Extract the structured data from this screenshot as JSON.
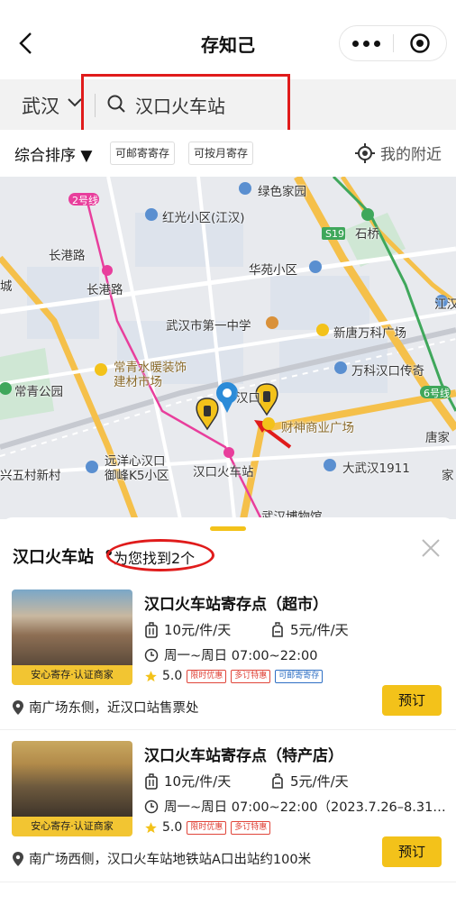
{
  "nav": {
    "title": "存知己"
  },
  "search": {
    "city": "武汉",
    "query": "汉口火车站"
  },
  "filters": {
    "sort": "综合排序 ▼",
    "chips": [
      "可邮寄寄存",
      "可按月寄存"
    ],
    "nearby": "我的附近"
  },
  "map": {
    "labels": [
      "绿色家园",
      "红光小区(江汉)",
      "石桥",
      "S19",
      "长港路",
      "长港路",
      "华苑小区",
      "江汉",
      "城",
      "武汉市第一中学",
      "新唐万科广场",
      "常青水暖装饰",
      "建材市场",
      "万科汉口传奇",
      "常青公园",
      "汉口",
      "财神商业广场",
      "6号线",
      "唐家",
      "远洋心汉口",
      "御峰K5小区",
      "汉口火车站",
      "大武汉1911",
      "兴五村新村",
      "家",
      "2号线",
      "武汉博物馆"
    ]
  },
  "results": {
    "title": "汉口火车站",
    "count_text": "为您找到2个",
    "items": [
      {
        "name": "汉口火车站寄存点（超市）",
        "price_small": "10元/件/天",
        "price_large": "5元/件/天",
        "hours": "周一~周日 07:00~22:00",
        "rating": "5.0",
        "tags": [
          "限时优惠",
          "多订特惠",
          "可邮寄寄存"
        ],
        "badge": "安心寄存·认证商家",
        "address": "南广场东侧，近汉口站售票处",
        "book_label": "预订"
      },
      {
        "name": "汉口火车站寄存点（特产店）",
        "price_small": "10元/件/天",
        "price_large": "5元/件/天",
        "hours": "周一~周日 07:00~22:00（2023.7.26–8.31…",
        "rating": "5.0",
        "tags": [
          "限时优惠",
          "多订特惠"
        ],
        "badge": "安心寄存·认证商家",
        "address": "南广场西侧，汉口火车站地铁站A口出站约100米",
        "book_label": "预订"
      }
    ]
  },
  "colors": {
    "accent": "#f3c21a",
    "annotation": "#e01b1b",
    "metro": "#e83e9c",
    "road": "#f5c04a"
  }
}
